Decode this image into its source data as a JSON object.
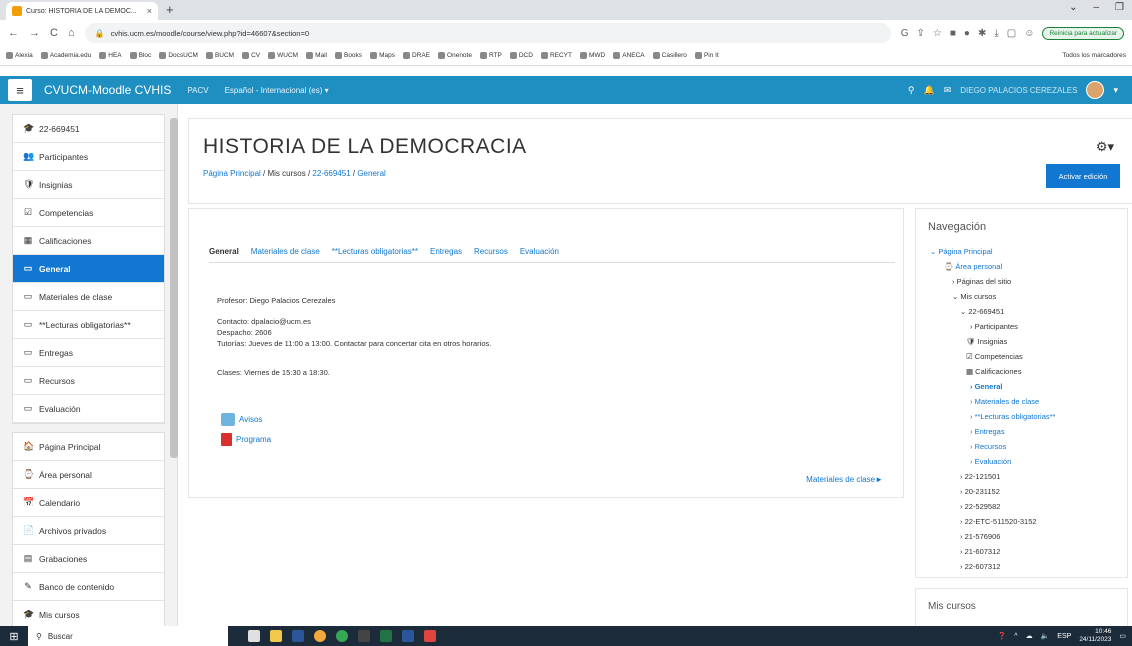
{
  "browser": {
    "tab_title": "Curso: HISTORIA DE LA DEMOC...",
    "url": "cvhis.ucm.es/moodle/course/view.php?id=46607&section=0",
    "restart_label": "Reinicia para actualizar",
    "bookmarks": [
      "Alexia",
      "Academia.edu",
      "HEA",
      "Bloc",
      "DocsUCM",
      "BUCM",
      "CV",
      "WUCM",
      "Mail",
      "Books",
      "Maps",
      "DRAE",
      "Onenote",
      "RTP",
      "DCD",
      "RECYT",
      "MWD",
      "ANECA",
      "Casillero",
      "Pin It"
    ],
    "all_bookmarks": "Todos los marcadores"
  },
  "navbar": {
    "brand": "CVUCM-Moodle CVHIS",
    "pacv": "PACV",
    "language": "Español - Internacional (es)",
    "user": "DIEGO PALACIOS CEREZALES"
  },
  "sidebar": {
    "group1": [
      {
        "icon": "🎓",
        "label": "22-669451"
      },
      {
        "icon": "👥",
        "label": "Participantes"
      },
      {
        "icon": "🛡",
        "label": "Insignias"
      },
      {
        "icon": "☑",
        "label": "Competencias"
      },
      {
        "icon": "▦",
        "label": "Calificaciones"
      },
      {
        "icon": "▭",
        "label": "General",
        "active": true
      },
      {
        "icon": "▭",
        "label": "Materiales de clase"
      },
      {
        "icon": "▭",
        "label": "**Lecturas obligatorias**"
      },
      {
        "icon": "▭",
        "label": "Entregas"
      },
      {
        "icon": "▭",
        "label": "Recursos"
      },
      {
        "icon": "▭",
        "label": "Evaluación"
      }
    ],
    "group2": [
      {
        "icon": "🏠",
        "label": "Página Principal"
      },
      {
        "icon": "⌚",
        "label": "Área personal"
      },
      {
        "icon": "📅",
        "label": "Calendario"
      },
      {
        "icon": "📄",
        "label": "Archivos privados"
      },
      {
        "icon": "▤",
        "label": "Grabaciones"
      },
      {
        "icon": "✎",
        "label": "Banco de contenido"
      },
      {
        "icon": "🎓",
        "label": "Mis cursos"
      }
    ]
  },
  "header": {
    "title": "HISTORIA DE LA DEMOCRACIA",
    "crumb_home": "Página Principal",
    "crumb_sep": " / ",
    "crumb_mycourses": "Mis cursos",
    "crumb_course": "22-669451",
    "crumb_section": "General",
    "edit_button": "Activar edición"
  },
  "content": {
    "tabs": [
      "General",
      "Materiales de clase",
      "**Lecturas obligatorias**",
      "Entregas",
      "Recursos",
      "Evaluación"
    ],
    "profesor": "Profesor: Diego Palacios Cerezales",
    "contacto": "Contacto: dpalacio@ucm.es",
    "despacho": "Despacho: 2606",
    "tutorias": "Tutorías: Jueves de 11:00 a 13:00. Contactar para concertar cita en otros horarios.",
    "clases": "Clases: Viernes de 15:30 a 18:30.",
    "avisos": "Avisos",
    "programa": "Programa",
    "next_link": "Materiales de clase►"
  },
  "navigation": {
    "title": "Navegación",
    "items": [
      {
        "text": "⌄ Página Principal",
        "link": true,
        "indent": 0
      },
      {
        "text": "⌚ Área personal",
        "link": true,
        "indent": 14
      },
      {
        "text": "› Páginas del sitio",
        "link": false,
        "indent": 22
      },
      {
        "text": "⌄ Mis cursos",
        "link": false,
        "indent": 22
      },
      {
        "text": "⌄ 22-669451",
        "link": false,
        "indent": 30
      },
      {
        "text": "› Participantes",
        "link": false,
        "indent": 40
      },
      {
        "text": "🛡 Insignias",
        "link": false,
        "indent": 36
      },
      {
        "text": "☑ Competencias",
        "link": false,
        "indent": 36
      },
      {
        "text": "▦ Calificaciones",
        "link": false,
        "indent": 36
      },
      {
        "text": "› General",
        "link": true,
        "bold": true,
        "indent": 40
      },
      {
        "text": "› Materiales de clase",
        "link": true,
        "indent": 40
      },
      {
        "text": "› **Lecturas obligatorias**",
        "link": true,
        "indent": 40
      },
      {
        "text": "› Entregas",
        "link": true,
        "indent": 40
      },
      {
        "text": "› Recursos",
        "link": true,
        "indent": 40
      },
      {
        "text": "› Evaluación",
        "link": true,
        "indent": 40
      },
      {
        "text": "› 22-121501",
        "link": false,
        "indent": 30
      },
      {
        "text": "› 20-231152",
        "link": false,
        "indent": 30
      },
      {
        "text": "› 22-529582",
        "link": false,
        "indent": 30
      },
      {
        "text": "› 22-ETC-511520-3152",
        "link": false,
        "indent": 30
      },
      {
        "text": "› 21-576906",
        "link": false,
        "indent": 30
      },
      {
        "text": "› 21-607312",
        "link": false,
        "indent": 30
      },
      {
        "text": "› 22-607312",
        "link": false,
        "indent": 30
      }
    ]
  },
  "mycourses_block": {
    "title": "Mis cursos"
  },
  "taskbar": {
    "search": "Buscar",
    "lang": "ESP",
    "time": "10:46",
    "date": "24/11/2023"
  }
}
